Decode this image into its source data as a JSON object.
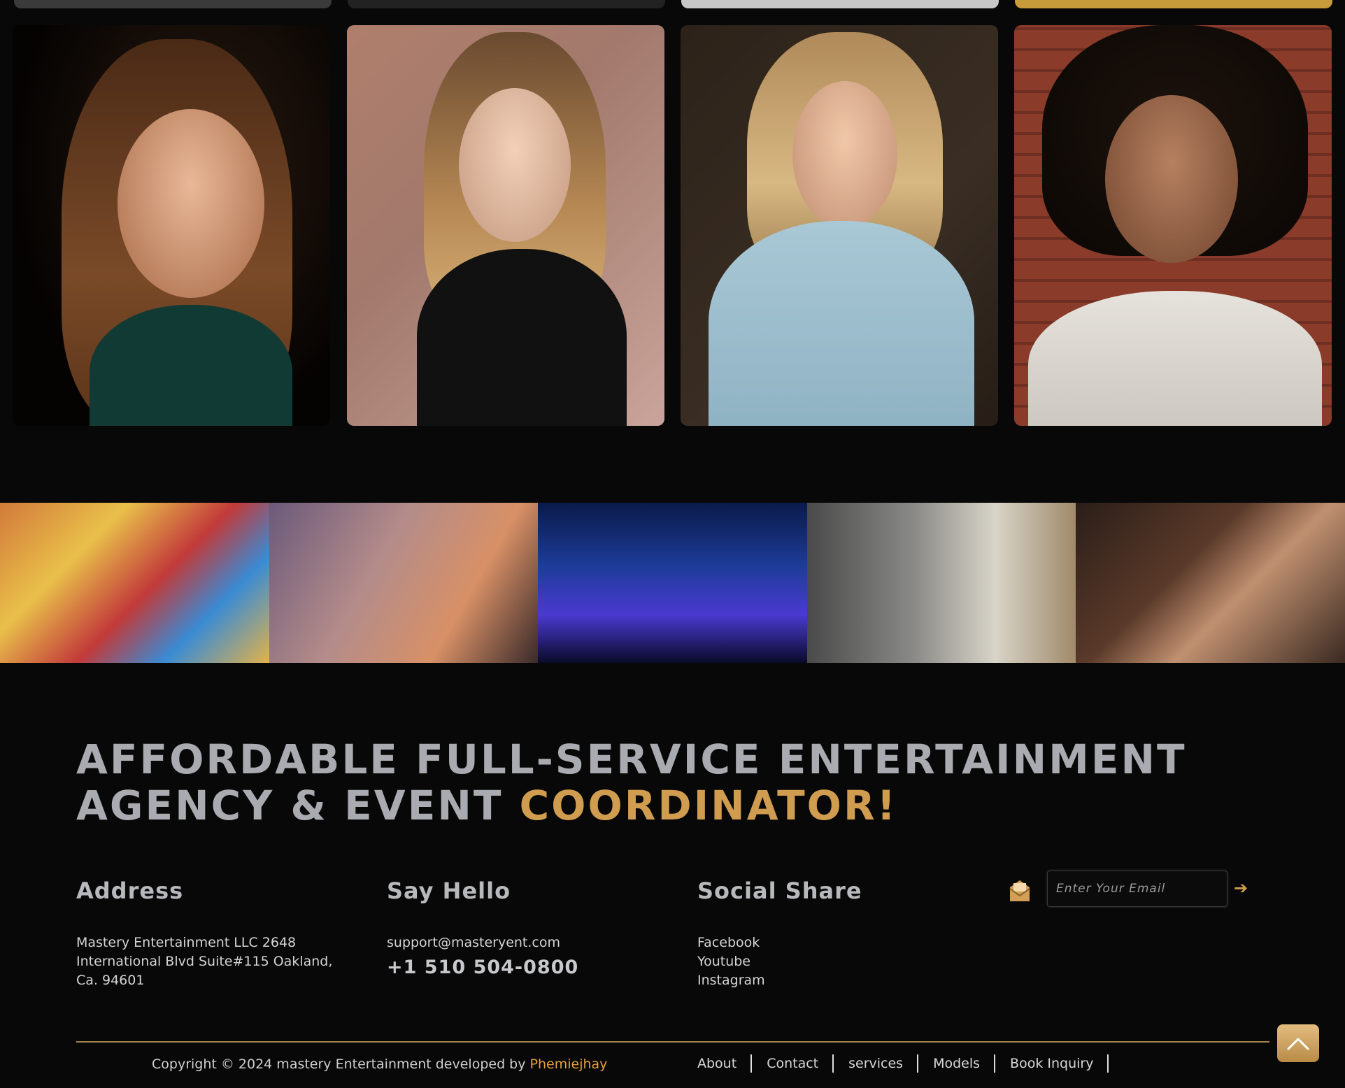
{
  "headline": {
    "line1": "AFFORDABLE FULL-SERVICE ENTERTAINMENT",
    "line2_plain": "AGENCY & EVENT ",
    "line2_accent": "COORDINATOR!"
  },
  "colors": {
    "accent": "#cf9c50",
    "background": "#080808",
    "divider": "#a0824a"
  },
  "models": [
    {
      "name": "model-photo-1",
      "icon": "portrait-photo"
    },
    {
      "name": "model-photo-2",
      "icon": "portrait-photo"
    },
    {
      "name": "model-photo-3",
      "icon": "portrait-photo"
    },
    {
      "name": "model-photo-4",
      "icon": "portrait-photo"
    }
  ],
  "events": [
    {
      "name": "event-photo-crowd"
    },
    {
      "name": "event-photo-party"
    },
    {
      "name": "event-photo-concert"
    },
    {
      "name": "event-photo-film-set"
    },
    {
      "name": "event-photo-dinner"
    }
  ],
  "address": {
    "title": "Address",
    "text": "Mastery Entertainment LLC 2648 International Blvd Suite#115 Oakland, Ca. 94601"
  },
  "contact": {
    "title": "Say Hello",
    "email": "support@masteryent.com",
    "phone": "+1 510 504-0800"
  },
  "social": {
    "title": "Social Share",
    "links": [
      "Facebook",
      "Youtube",
      "Instagram"
    ]
  },
  "newsletter": {
    "placeholder": "Enter Your Email",
    "icon": "mail-icon",
    "submit_icon": "arrow-right-icon",
    "submit_glyph": "➔"
  },
  "copyright": {
    "text": "Copyright © 2024 mastery Entertainment developed by ",
    "developer": "Phemiejhay"
  },
  "footer_nav": [
    "About",
    "Contact",
    "services",
    "Models",
    "Book Inquiry"
  ],
  "scroll_top": {
    "icon": "chevron-up-icon"
  }
}
